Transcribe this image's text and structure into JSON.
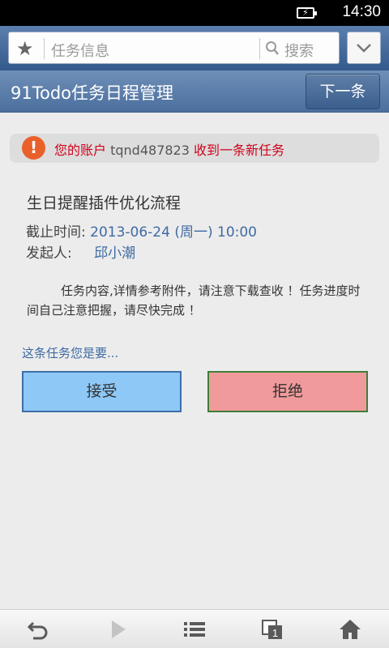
{
  "status_bar": {
    "time": "14:30"
  },
  "browser": {
    "url_text": "任务信息",
    "search_label": "搜索"
  },
  "header": {
    "title": "91Todo任务日程管理",
    "next_button": "下一条"
  },
  "notice": {
    "prefix": "您的账户",
    "account": "tqnd487823",
    "suffix": "收到一条新任务",
    "icon_text": "!"
  },
  "task": {
    "title": "生日提醒插件优化流程",
    "deadline_label": "截止时间:",
    "deadline_value": "2013-06-24 (周一) 10:00",
    "initiator_label": "发起人:",
    "initiator_value": "邱小潮",
    "content": "任务内容,详情参考附件，请注意下载查收 ！任务进度时间自己注意把握，请尽快完成 ！"
  },
  "actions": {
    "prompt": "这条任务您是要...",
    "accept": "接受",
    "reject": "拒绝"
  },
  "bottom_nav": {
    "icons": [
      "back-icon",
      "forward-icon",
      "list-icon",
      "windows-icon",
      "home-icon"
    ],
    "windows_count": "1"
  },
  "colors": {
    "accent_blue": "#3f6aa3",
    "alert_red": "#d0021b",
    "accept_bg": "#8ec8f6",
    "reject_bg": "#f19a9b"
  }
}
